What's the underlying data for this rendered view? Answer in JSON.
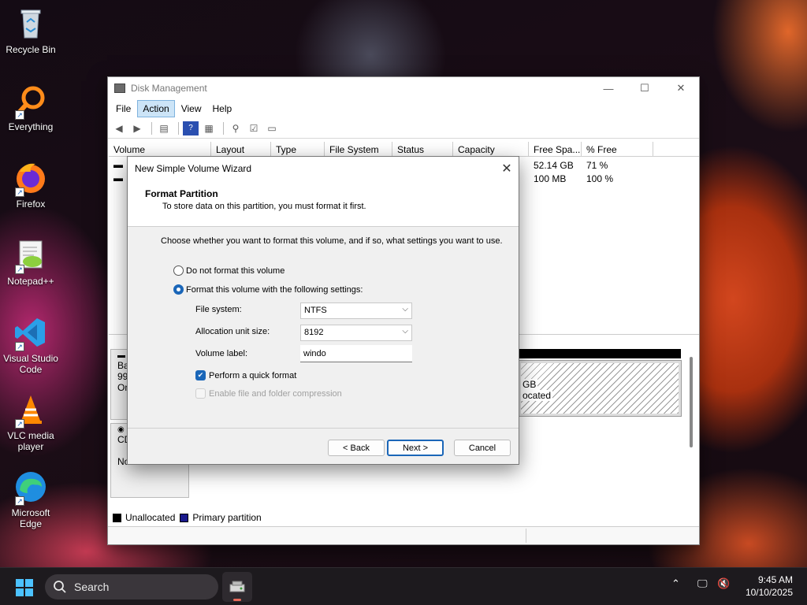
{
  "desktop": {
    "icons": [
      {
        "label": "Recycle Bin"
      },
      {
        "label": "Everything"
      },
      {
        "label": "Firefox"
      },
      {
        "label": "Notepad++"
      },
      {
        "label": "Visual Studio Code"
      },
      {
        "label": "VLC media player"
      },
      {
        "label": "Microsoft Edge"
      }
    ]
  },
  "window": {
    "title": "Disk Management",
    "menu": [
      "File",
      "Action",
      "View",
      "Help"
    ],
    "active_menu": "Action",
    "columns": [
      "Volume",
      "Layout",
      "Type",
      "File System",
      "Status",
      "Capacity",
      "Free Spa...",
      "% Free"
    ],
    "rows": [
      {
        "free": "52.14 GB",
        "pct_free": "71 %"
      },
      {
        "free": "100 MB",
        "pct_free": "100 %"
      }
    ],
    "disks": [
      {
        "line1": "Ba",
        "line2": "99.",
        "line3": "On"
      },
      {
        "line1": "CD",
        "line2": "",
        "line3": "No Media"
      }
    ],
    "unallocated": {
      "line1": "GB",
      "line2": "ocated"
    },
    "legend": [
      {
        "label": "Unallocated",
        "color": "#000000"
      },
      {
        "label": "Primary partition",
        "color": "#1a1a8c"
      }
    ]
  },
  "wizard": {
    "title": "New Simple Volume Wizard",
    "heading": "Format Partition",
    "subheading": "To store data on this partition, you must format it first.",
    "instruction": "Choose whether you want to format this volume, and if so, what settings you want to use.",
    "option_no_format": "Do not format this volume",
    "option_format": "Format this volume with the following settings:",
    "file_system_label": "File system:",
    "file_system_value": "NTFS",
    "alloc_label": "Allocation unit size:",
    "alloc_value": "8192",
    "volume_label_label": "Volume label:",
    "volume_label_value": "windo",
    "quick_format_label": "Perform a quick format",
    "compression_label": "Enable file and folder compression",
    "back_label": "< Back",
    "next_label": "Next >",
    "cancel_label": "Cancel"
  },
  "taskbar": {
    "search_label": "Search",
    "time": "9:45 AM",
    "date": "10/10/2025"
  },
  "colors": {
    "accent": "#1a66b8",
    "menu_highlight": "#cce4f7"
  }
}
